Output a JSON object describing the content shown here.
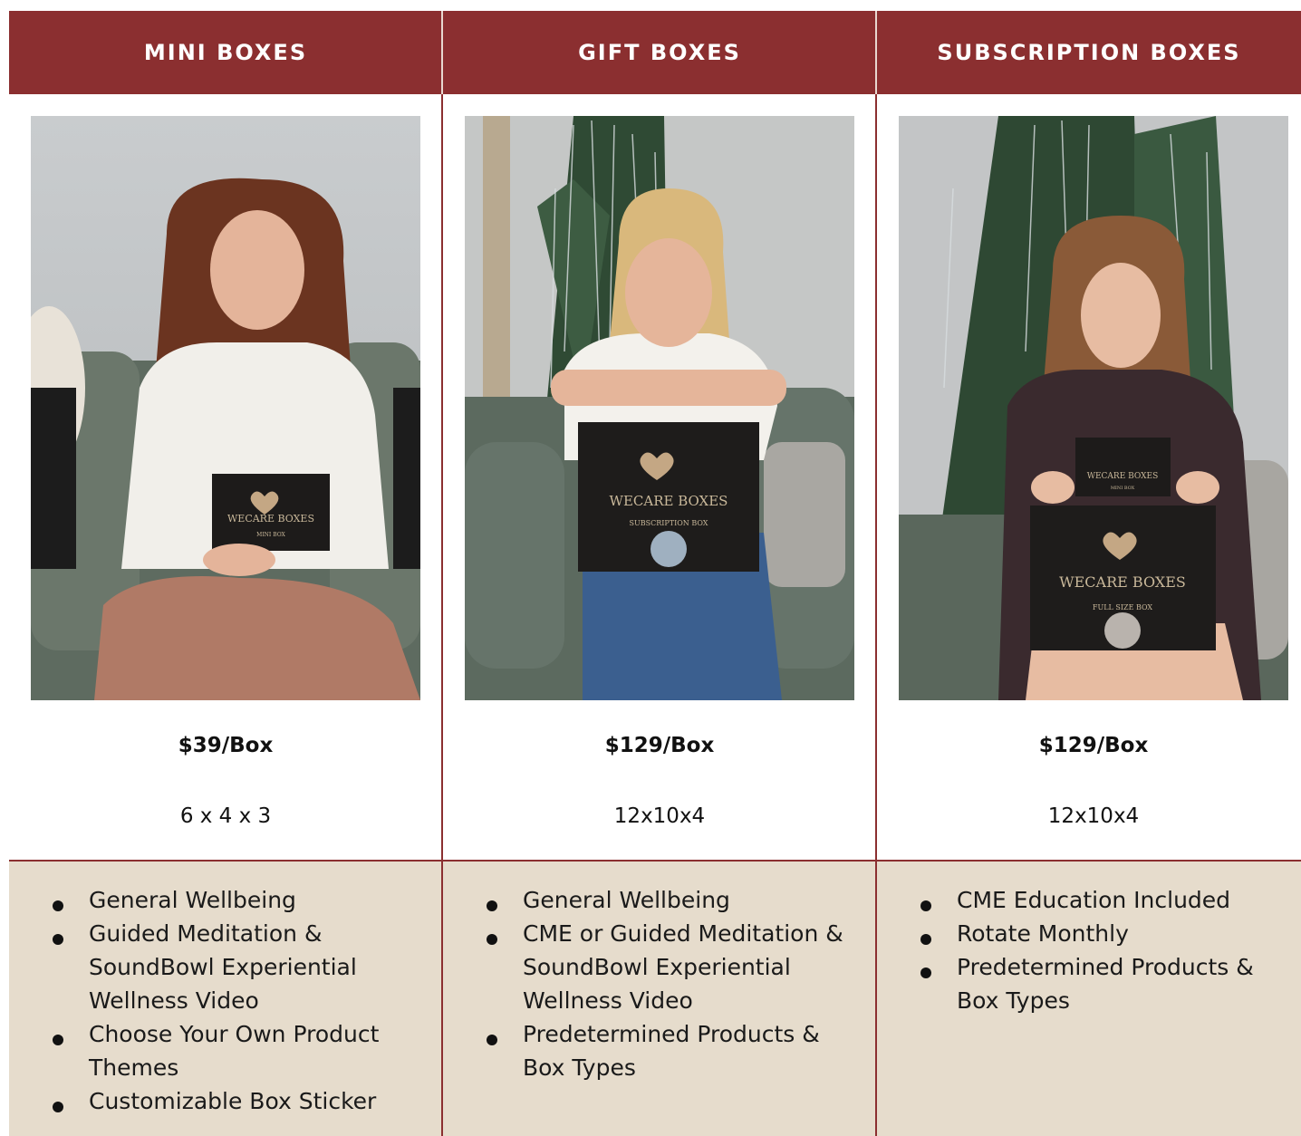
{
  "columns": [
    {
      "title": "MINI BOXES",
      "price": "$39/Box",
      "dimensions": "6 x 4 x 3",
      "features": [
        "General Wellbeing",
        "Guided Meditation & SoundBowl Experiential Wellness Video",
        "Choose Your Own Product Themes",
        "Customizable Box Sticker"
      ],
      "box_text": {
        "brand": "WECARE BOXES",
        "type": "MINI BOX"
      }
    },
    {
      "title": "GIFT BOXES",
      "price": "$129/Box",
      "dimensions": "12x10x4",
      "features": [
        "General Wellbeing",
        "CME or Guided Meditation & SoundBowl Experiential Wellness Video",
        "Predetermined Products & Box Types"
      ],
      "box_text": {
        "brand": "WECARE BOXES",
        "type": "SUBSCRIPTION BOX"
      }
    },
    {
      "title": "SUBSCRIPTION BOXES",
      "price": "$129/Box",
      "dimensions": "12x10x4",
      "features": [
        "CME Education Included",
        "Rotate Monthly",
        "Predetermined Products & Box Types"
      ],
      "box_text": {
        "brand": "WECARE BOXES",
        "type": "FULL SIZE BOX",
        "mini_brand": "WECARE BOXES",
        "mini_type": "MINI BOX"
      }
    }
  ],
  "colors": {
    "header": "#8b2f30",
    "band": "#e6dccc",
    "text": "#111111"
  }
}
